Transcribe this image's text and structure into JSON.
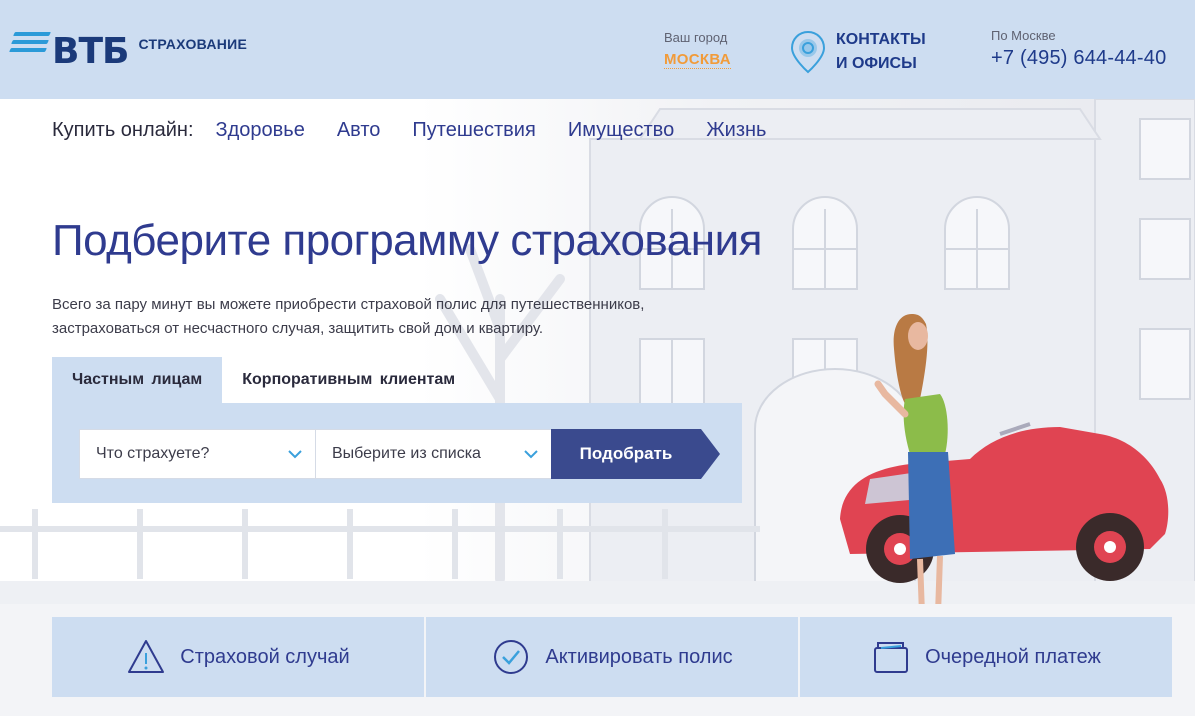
{
  "header": {
    "logo_text": "ВТБ",
    "logo_subtext": "СТРАХОВАНИЕ",
    "city_label": "Ваш город",
    "city_value": "МОСКВА",
    "contacts_line1": "КОНТАКТЫ",
    "contacts_line2": "И ОФИСЫ",
    "phone_label": "По Москве",
    "phone_value": "+7 (495) 644-44-40"
  },
  "nav": {
    "buy_label": "Купить онлайн:",
    "links": [
      "Здоровье",
      "Авто",
      "Путешествия",
      "Имущество",
      "Жизнь"
    ]
  },
  "hero": {
    "title": "Подберите программу страхования",
    "desc_line1": "Всего за пару минут вы можете приобрести страховой полис для путешественников,",
    "desc_line2": "застраховаться от несчастного случая, защитить свой дом и квартиру."
  },
  "tabs": [
    "Частным лицам",
    "Корпоративным клиентам"
  ],
  "form": {
    "select1": "Что страхуете?",
    "select2": "Выберите из списка",
    "submit": "Подобрать"
  },
  "cards": [
    {
      "label": "Страховой случай",
      "icon": "warning-triangle-icon"
    },
    {
      "label": "Активировать полис",
      "icon": "check-circle-icon"
    },
    {
      "label": "Очередной платеж",
      "icon": "wallet-icon"
    }
  ],
  "colors": {
    "brand_blue": "#2f3b8f",
    "light_panel": "#cdddf1",
    "accent_orange": "#f19b3a",
    "logo_stripe": "#2b9ad8",
    "button_dark": "#3a4a8e"
  }
}
